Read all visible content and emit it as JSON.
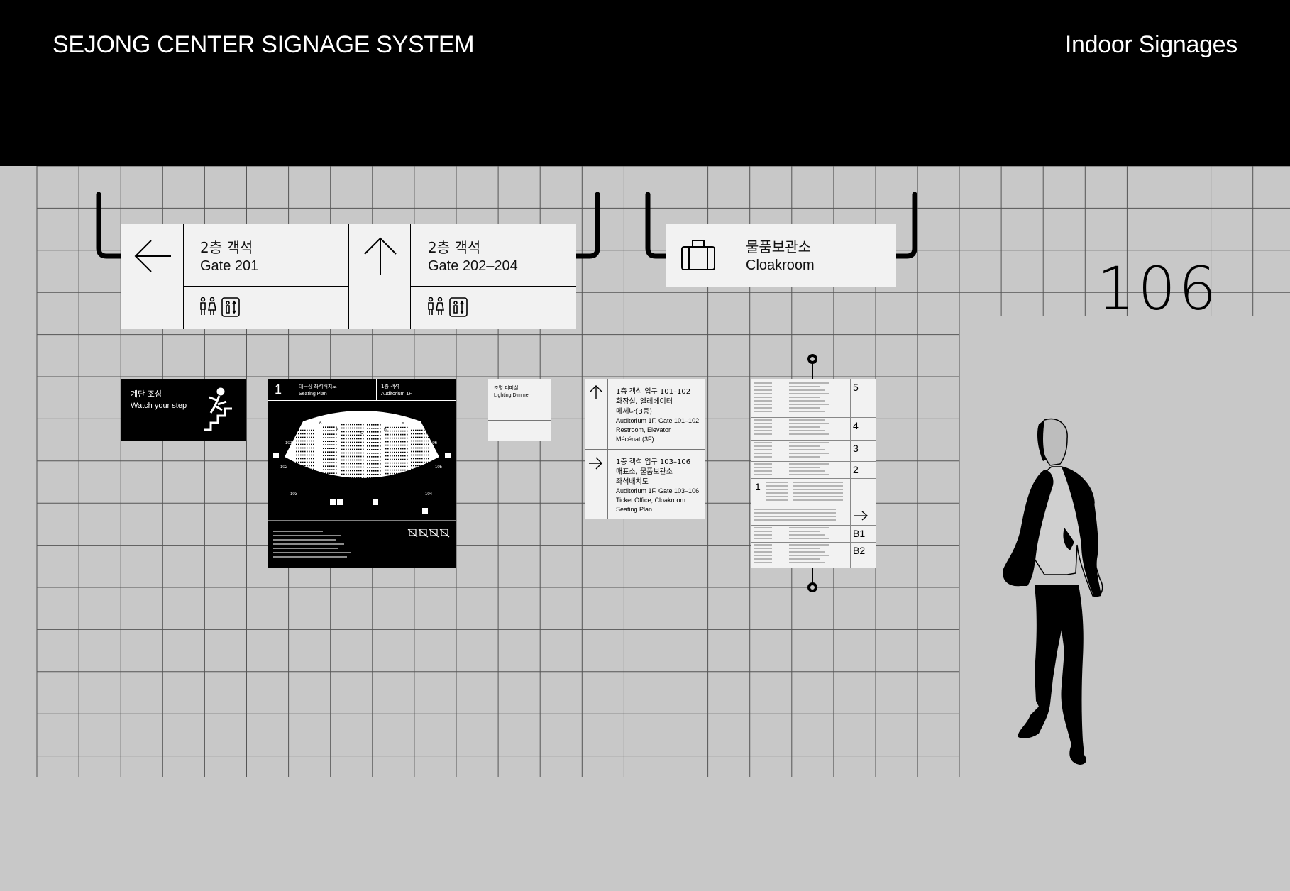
{
  "header": {
    "title": "SEJONG CENTER SIGNAGE SYSTEM",
    "subtitle": "Indoor Signages"
  },
  "hanging_signs": [
    {
      "arrow": "left-arrow-icon",
      "kor": "2층 객석",
      "eng": "Gate 201"
    },
    {
      "arrow": "up-arrow-icon",
      "kor": "2층 객석",
      "eng": "Gate 202–204"
    }
  ],
  "cloakroom_sign": {
    "kor": "물품보관소",
    "eng": "Cloakroom"
  },
  "room_number": "106",
  "step_sign": {
    "kor": "계단 조심",
    "eng": "Watch your step"
  },
  "seating_plan": {
    "floor_number": "1",
    "title_kor": "대극장 좌석배치도",
    "title_eng": "Seating Plan",
    "level_kor": "1층 객석",
    "level_eng": "Auditorium 1F",
    "stage": "Stage",
    "sections": [
      "A",
      "B",
      "C",
      "D",
      "E"
    ],
    "gates": [
      "101",
      "102",
      "103",
      "104",
      "105",
      "106"
    ]
  },
  "dimmer_sign": {
    "kor": "조명 디머실",
    "eng": "Lighting Dimmer"
  },
  "direction_sign": [
    {
      "kor1": "1층 객석 입구 101–102",
      "kor2": "화장실, 엘레베이터",
      "kor3": "메세나(3층)",
      "eng1": "Auditorium 1F, Gate 101–102",
      "eng2": "Restroom, Elevator",
      "eng3": "Mécénat (3F)"
    },
    {
      "kor1": "1층 객석 입구 103–106",
      "kor2": "매표소, 물품보관소",
      "kor3": "좌석배치도",
      "eng1": "Auditorium 1F, Gate 103–106",
      "eng2": "Ticket Office, Cloakroom",
      "eng3": "Seating Plan"
    }
  ],
  "directory": {
    "floors": [
      "5",
      "4",
      "3",
      "2",
      "1",
      "B1",
      "B2"
    ]
  }
}
